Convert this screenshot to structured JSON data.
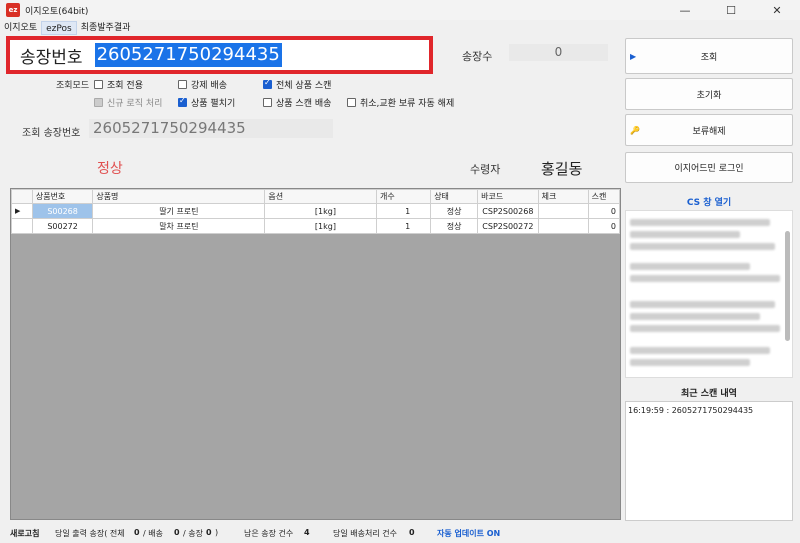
{
  "window": {
    "title": "이지오토(64bit)",
    "icon_text": "ez",
    "controls": {
      "minimize": "—",
      "maximize": "☐",
      "close": "✕"
    }
  },
  "menu": [
    "이지오토",
    "ezPos",
    "최종발주결과"
  ],
  "invoice": {
    "label": "송장번호",
    "value": "2605271750294435"
  },
  "invoice_count": {
    "label": "송장수",
    "value": "0"
  },
  "lookup_mode_label": "조회모드",
  "checkboxes": [
    {
      "label": "조회 전용",
      "checked": false,
      "disabled": false
    },
    {
      "label": "강제 배송",
      "checked": false,
      "disabled": false
    },
    {
      "label": "전체 상품 스캔",
      "checked": true,
      "disabled": false
    },
    {
      "label": "신규 로직 처리",
      "checked": false,
      "disabled": true
    },
    {
      "label": "상품 펼치기",
      "checked": true,
      "disabled": false
    },
    {
      "label": "상품 스캔 배송",
      "checked": false,
      "disabled": false
    },
    {
      "label": "취소,교환 보류 자동 해제",
      "checked": false,
      "disabled": false
    }
  ],
  "lookup": {
    "label": "조회 송장번호",
    "value": "2605271750294435"
  },
  "status": "정상",
  "receiver": {
    "label": "수령자",
    "name": "홍길동"
  },
  "buttons": [
    {
      "label": "조회",
      "icon": "▶"
    },
    {
      "label": "초기화",
      "icon": ""
    },
    {
      "label": "보류해제",
      "icon": "🔑"
    },
    {
      "label": "이지어드민 로그인",
      "icon": ""
    }
  ],
  "table": {
    "columns": [
      "",
      "상품번호",
      "상품명",
      "옵션",
      "개수",
      "상태",
      "바코드",
      "체크",
      "스캔"
    ],
    "rows": [
      {
        "marker": "▶",
        "code": "S00268",
        "name": "딸기 프로틴",
        "option": "[1kg]",
        "qty": "1",
        "state": "정상",
        "barcode": "CSP2S00268",
        "check": "",
        "scan": "0"
      },
      {
        "marker": "",
        "code": "S00272",
        "name": "말차 프로틴",
        "option": "[1kg]",
        "qty": "1",
        "state": "정상",
        "barcode": "CSP2S00272",
        "check": "",
        "scan": "0"
      }
    ]
  },
  "cs": {
    "title": "CS 창 열기"
  },
  "recent": {
    "title": "최근 스캔 내역",
    "line": "16:19:59 :  2605271750294435"
  },
  "statusbar": {
    "refresh": "새로고침",
    "daily_print": "당일 출력 송장( 전체",
    "daily_total": "0",
    "ship_sep": "/ 배송",
    "daily_ship": "0",
    "hold_sep": "/ 송장",
    "daily_hold": "0",
    "close_paren": ")",
    "remaining_label": "남은 송장 건수",
    "remaining": "4",
    "shipped_label": "당일 배송처리 건수",
    "shipped": "0",
    "auto_update": "자동 업데이트 ON"
  }
}
